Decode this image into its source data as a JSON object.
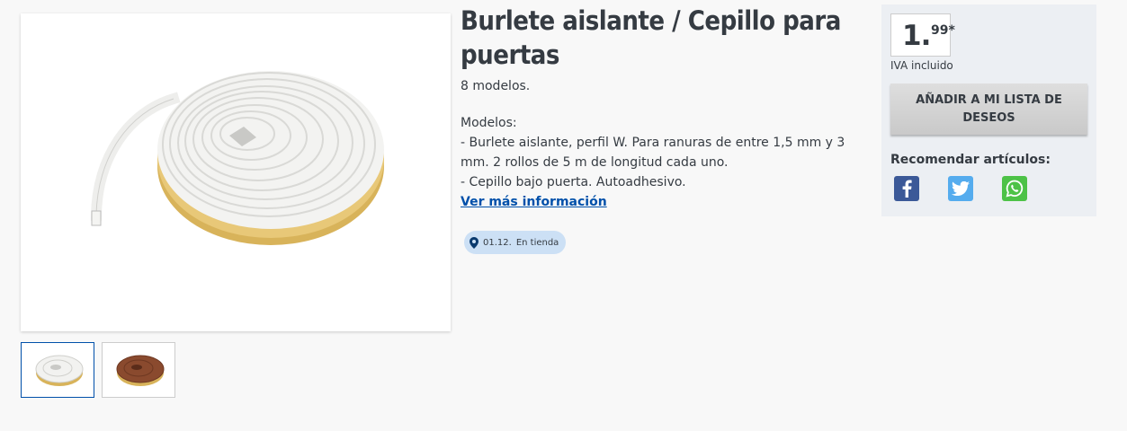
{
  "product": {
    "title": "Burlete aislante / Cepillo para puertas",
    "models_count": "8 modelos.",
    "description": {
      "heading": "Modelos:",
      "lines": [
        "- Burlete aislante, perfil W. Para ranuras de entre 1,5 mm y 3 mm. 2 rollos de 5 m de longitud cada uno.",
        "- Cepillo bajo puerta. Autoadhesivo."
      ],
      "more_link": "Ver más información"
    },
    "availability": {
      "date": "01.12.",
      "label": "En tienda",
      "icon": "map-pin-icon"
    },
    "thumbnails": [
      "white-seal-roll",
      "brown-seal-roll"
    ]
  },
  "sidebar": {
    "price_integer": "1.",
    "price_cents": "99*",
    "vat_note": "IVA incluido",
    "wishlist_button": "AÑADIR A MI LISTA DE DESEOS",
    "recommend_label": "Recomendar artículos:",
    "share": [
      {
        "name": "facebook",
        "icon": "facebook-icon",
        "color": "#3b5998"
      },
      {
        "name": "twitter",
        "icon": "twitter-icon",
        "color": "#55acee"
      },
      {
        "name": "whatsapp",
        "icon": "whatsapp-icon",
        "color": "#4dc247"
      }
    ]
  },
  "colors": {
    "link": "#0050aa",
    "badge": "#cce0f5",
    "sidebar_bg": "#eceff3"
  }
}
